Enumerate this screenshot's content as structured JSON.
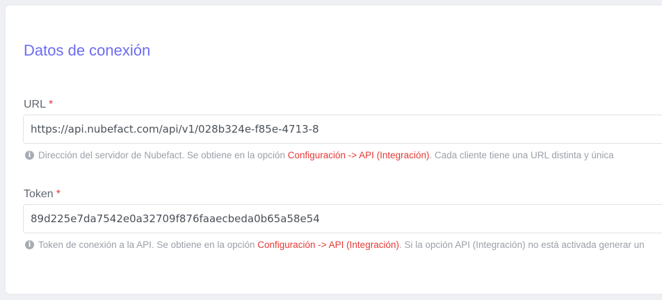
{
  "section": {
    "title": "Datos de conexión"
  },
  "url_field": {
    "label": "URL",
    "required_mark": "*",
    "value": "https://api.nubefact.com/api/v1/028b324e-f85e-4713-8",
    "hint_before": "Dirección del servidor de Nubefact. Se obtiene en la opción ",
    "hint_link": "Configuración -> API (Integración)",
    "hint_after": ". Cada cliente tiene una URL distinta y única"
  },
  "token_field": {
    "label": "Token",
    "required_mark": "*",
    "value": "89d225e7da7542e0a32709f876faaecbeda0b65a58e54",
    "hint_before": "Token de conexión a la API. Se obtiene en la opción ",
    "hint_link": "Configuración -> API (Integración)",
    "hint_after": ". Si la opción API (Integración) no está activada generar un"
  },
  "icons": {
    "info": "info-icon"
  },
  "colors": {
    "title": "#6c6cf2",
    "required": "#e53935",
    "link": "#e53935"
  }
}
